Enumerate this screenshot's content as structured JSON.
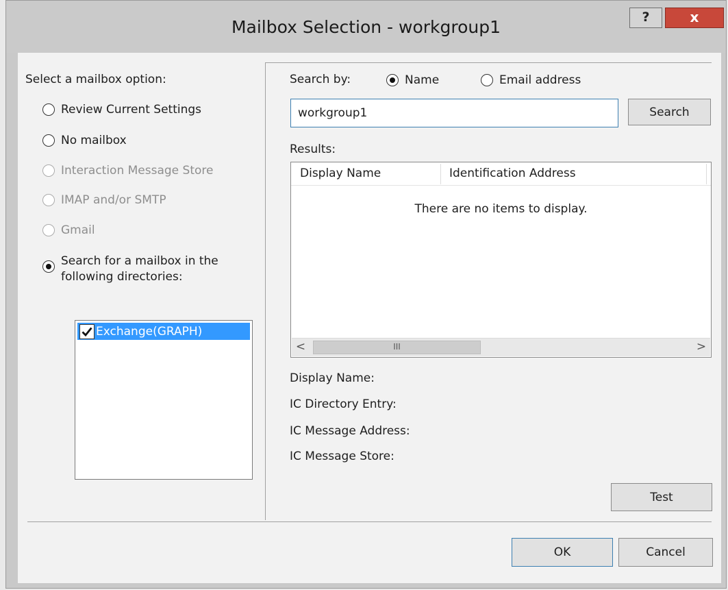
{
  "window": {
    "title": "Mailbox Selection - workgroup1",
    "help_label": "?",
    "close_label": "x"
  },
  "options": {
    "heading": "Select a mailbox option:",
    "items": [
      {
        "label": "Review Current Settings"
      },
      {
        "label": "No mailbox"
      },
      {
        "label": "Interaction Message Store"
      },
      {
        "label": "IMAP and/or SMTP"
      },
      {
        "label": "Gmail"
      },
      {
        "label_line1": "Search for a mailbox in the",
        "label_line2": "following directories:"
      }
    ],
    "selected": "Search for a mailbox in the following directories:",
    "directories": [
      {
        "label": "Exchange(GRAPH)",
        "checked": true
      }
    ]
  },
  "search": {
    "by_label": "Search by:",
    "by_options": [
      "Name",
      "Email address"
    ],
    "by_selected": "Name",
    "value": "workgroup1",
    "button_label": "Search"
  },
  "results": {
    "label": "Results:",
    "columns": [
      "Display Name",
      "Identification Address"
    ],
    "empty_message": "There are no items to display.",
    "scroll_left": "<",
    "scroll_right": ">",
    "scroll_grip": "III"
  },
  "details": {
    "display_name_label": "Display Name:",
    "directory_entry_label": "IC Directory Entry:",
    "message_address_label": "IC Message Address:",
    "message_store_label": "IC Message Store:"
  },
  "buttons": {
    "test": "Test",
    "ok": "OK",
    "cancel": "Cancel"
  },
  "colors": {
    "selection": "#3399ff",
    "close_button": "#c8483a",
    "focus_border": "#3c7fb1"
  }
}
